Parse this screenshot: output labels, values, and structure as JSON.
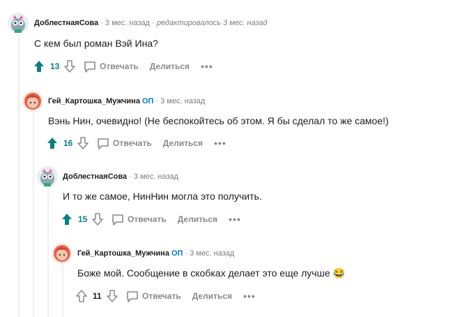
{
  "colors": {
    "upvoted": "#0e7e80",
    "neutral": "#878a8c",
    "op": "#0079d3",
    "thread": "#edeff1"
  },
  "comments": [
    {
      "author": "ДоблестнаяСова",
      "op": "",
      "dot": "·",
      "time": "3 мес. назад",
      "edited": "· редактировалось 3 мес. назад",
      "text": "С кем был роман Вэй Ина?",
      "score": "13",
      "upvoted": true,
      "reply_label": "Отвечать",
      "share_label": "Делиться",
      "more": "•••",
      "avatar_icon": "owl-avatar-icon"
    },
    {
      "author": "Гей_Картошка_Мужчина",
      "op": "ОП",
      "dot": "·",
      "time": "3 мес. назад",
      "edited": "",
      "text": "Вэнь Нин, очевидно! (Не беспокойтесь об этом. Я бы сделал то же самое!)",
      "score": "16",
      "upvoted": true,
      "reply_label": "Отвечать",
      "share_label": "Делиться",
      "more": "•••",
      "avatar_icon": "red-hair-avatar-icon"
    },
    {
      "author": "ДоблестнаяСова",
      "op": "",
      "dot": "·",
      "time": "3 мес. назад",
      "edited": "",
      "text": "И то же самое, НинНин могла это получить.",
      "score": "15",
      "upvoted": true,
      "reply_label": "Отвечать",
      "share_label": "Делиться",
      "more": "•••",
      "avatar_icon": "owl-avatar-icon"
    },
    {
      "author": "Гей_Картошка_Мужчина",
      "op": "ОП",
      "dot": "·",
      "time": "3 мес. назад",
      "edited": "",
      "text": "Боже мой. Сообщение в скобках делает это еще лучше 😂",
      "score": "11",
      "upvoted": false,
      "reply_label": "Отвечать",
      "share_label": "Делиться",
      "more": "•••",
      "avatar_icon": "red-hair-avatar-icon"
    }
  ]
}
